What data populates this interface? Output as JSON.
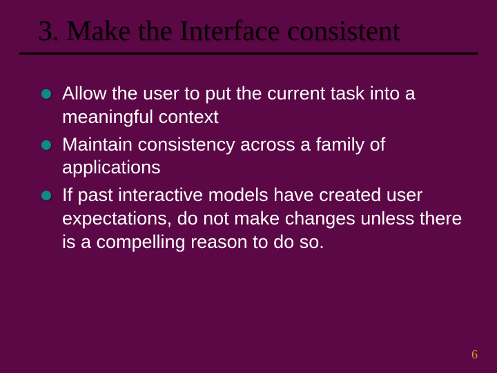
{
  "slide": {
    "title": "3. Make the Interface consistent",
    "bullets": [
      "Allow the user to put the current task into a meaningful context",
      "Maintain consistency across a family of applications",
      "If past interactive models have created user expectations, do not make changes unless there is a compelling reason to do so."
    ],
    "pageNumber": "6"
  },
  "colors": {
    "background": "#5c0846",
    "bullet": "#0a8a88",
    "title": "#000000",
    "text": "#ffffff",
    "pageNumber": "#d8a013"
  }
}
